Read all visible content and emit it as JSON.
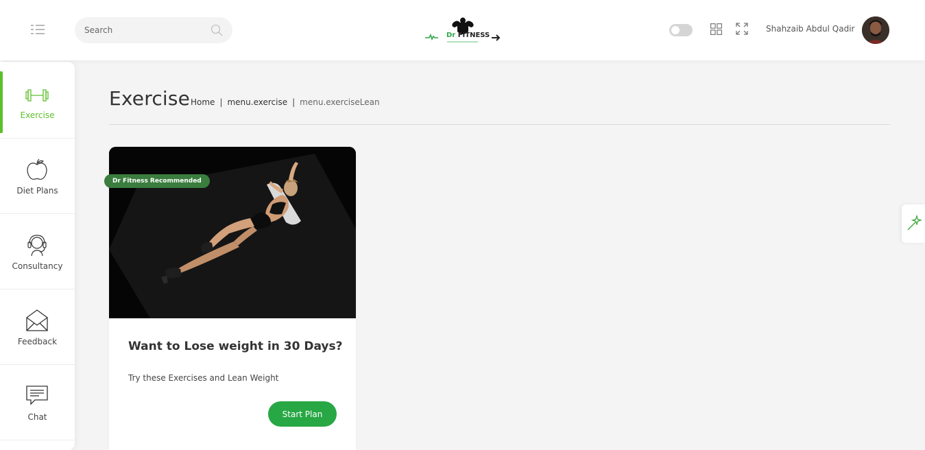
{
  "header": {
    "search_placeholder": "Search",
    "logo_text_dr": "Dr",
    "logo_text_fitness": "FITNESS",
    "user_name": "Shahzaib Abdul Qadir",
    "accent_color": "#5cbf2a"
  },
  "sidebar": {
    "items": [
      {
        "label": "Exercise",
        "icon": "dumbbell-icon",
        "active": true
      },
      {
        "label": "Diet Plans",
        "icon": "apple-icon",
        "active": false
      },
      {
        "label": "Consultancy",
        "icon": "headset-icon",
        "active": false
      },
      {
        "label": "Feedback",
        "icon": "envelope-icon",
        "active": false
      },
      {
        "label": "Chat",
        "icon": "chat-icon",
        "active": false
      }
    ]
  },
  "page": {
    "title": "Exercise",
    "breadcrumb": [
      "Home",
      "menu.exercise",
      "menu.exerciseLean"
    ]
  },
  "card": {
    "badge": "Dr Fitness Recommended",
    "title": "Want to Lose weight in 30 Days?",
    "description": "Try these Exercises and Lean Weight",
    "button_label": "Start Plan",
    "button_color": "#28a745"
  }
}
